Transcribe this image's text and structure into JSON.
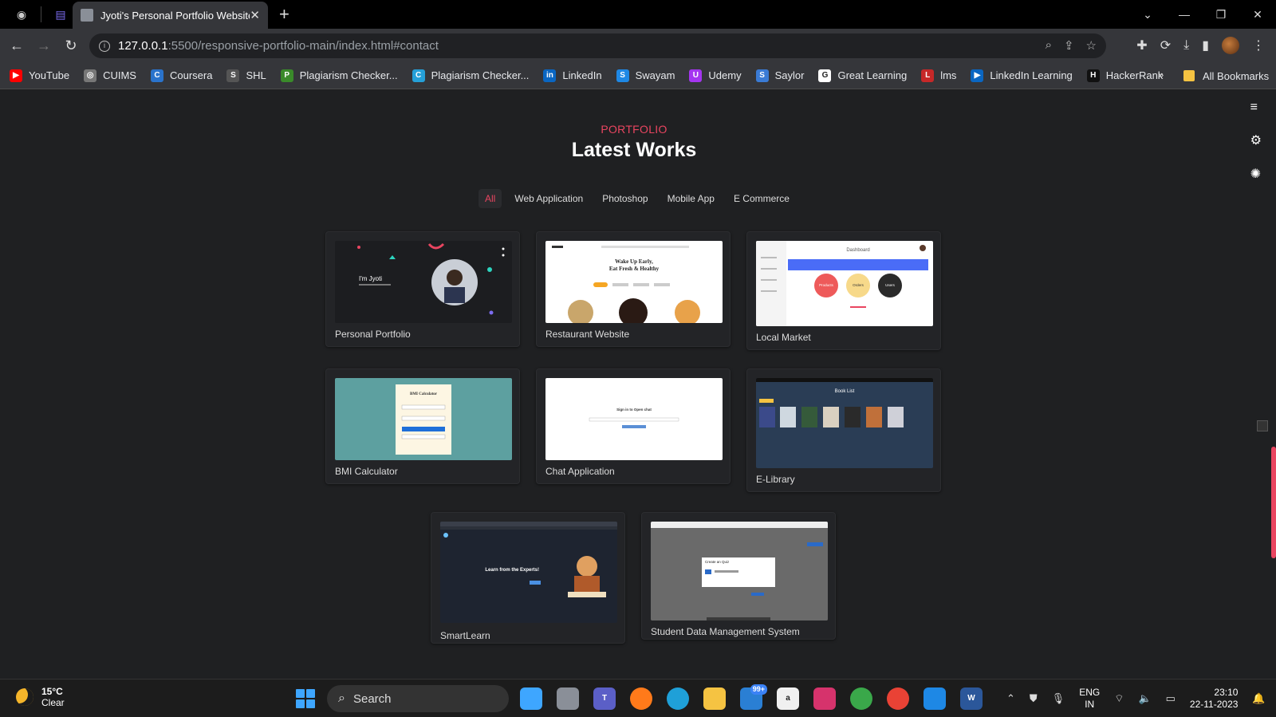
{
  "browser": {
    "tab_title": "Jyoti's Personal Portfolio Website",
    "url_host": "127.0.0.1",
    "url_path": ":5500/responsive-portfolio-main/index.html#contact",
    "bookmarks": [
      {
        "label": "YouTube",
        "color": "#ff0000",
        "glyph": "▶"
      },
      {
        "label": "CUIMS",
        "color": "#777777",
        "glyph": "◎"
      },
      {
        "label": "Coursera",
        "color": "#2a73cc",
        "glyph": "C"
      },
      {
        "label": "SHL",
        "color": "#555555",
        "glyph": "S"
      },
      {
        "label": "Plagiarism Checker...",
        "color": "#3a8a2a",
        "glyph": "P"
      },
      {
        "label": "Plagiarism Checker...",
        "color": "#25a0d8",
        "glyph": "C"
      },
      {
        "label": "LinkedIn",
        "color": "#0a66c2",
        "glyph": "in"
      },
      {
        "label": "Swayam",
        "color": "#1e88e5",
        "glyph": "S"
      },
      {
        "label": "Udemy",
        "color": "#a435f0",
        "glyph": "U"
      },
      {
        "label": "Saylor",
        "color": "#3a7bd5",
        "glyph": "S"
      },
      {
        "label": "Great Learning",
        "color": "#ffffff",
        "glyph": "G"
      },
      {
        "label": "lms",
        "color": "#c62828",
        "glyph": "L"
      },
      {
        "label": "LinkedIn Learning",
        "color": "#0a66c2",
        "glyph": "▶"
      },
      {
        "label": "HackerRank",
        "color": "#111111",
        "glyph": "H"
      }
    ],
    "more_glyph": "»",
    "all_bookmarks": "All Bookmarks"
  },
  "section": {
    "eyebrow": "PORTFOLIO",
    "title": "Latest Works"
  },
  "filters": [
    "All",
    "Web Application",
    "Photoshop",
    "Mobile App",
    "E Commerce"
  ],
  "projects": [
    {
      "label": "Personal Portfolio"
    },
    {
      "label": "Restaurant Website"
    },
    {
      "label": "Local Market"
    },
    {
      "label": "BMI Calculator"
    },
    {
      "label": "Chat Application"
    },
    {
      "label": "E-Library"
    },
    {
      "label": "SmartLearn"
    },
    {
      "label": "Student Data Management System"
    }
  ],
  "thumbs": {
    "portfolio_greeting": "I'm Jyoti",
    "restaurant_headline_1": "Wake Up Early,",
    "restaurant_headline_2": "Eat Fresh & Healthy",
    "market_title": "Dashboard",
    "market_circles": [
      "Products",
      "Orders",
      "Users"
    ],
    "bmi_title": "BMI Calculator",
    "chat_title": "Sign in to Open chat",
    "library_title": "Book List",
    "smart_title": "Learn from the Experts!",
    "student_title": "Create an Quiz"
  },
  "taskbar": {
    "temp": "15°C",
    "condition": "Clear",
    "search": "Search",
    "badge": "99+",
    "lang_1": "ENG",
    "lang_2": "IN",
    "time": "23:10",
    "date": "22-11-2023"
  },
  "colors": {
    "accent": "#e94560",
    "background": "#1f2022"
  }
}
